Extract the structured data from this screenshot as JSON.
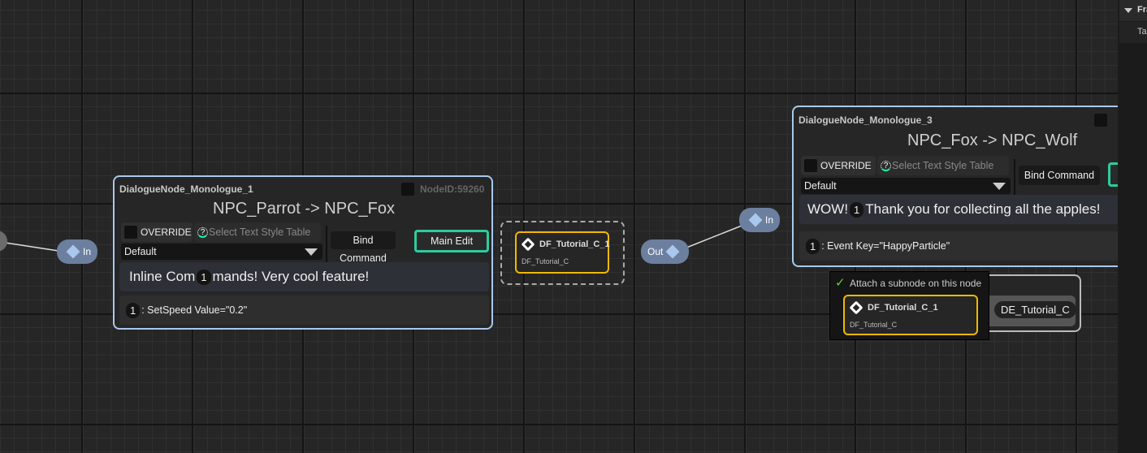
{
  "node1": {
    "title": "DialogueNode_Monologue_1",
    "node_id": "NodeID:59260",
    "speakers": "NPC_Parrot -> NPC_Fox",
    "override": "OVERRIDE",
    "style_table": "Select Text Style Table",
    "style_value": "Default",
    "bind_command": "Bind Command",
    "main_edit": "Main Edit",
    "text_before": "Inline Com",
    "text_marker": "1",
    "text_after": "mands! Very cool feature!",
    "command_index": "1",
    "command": ": SetSpeed Value=\"0.2\"",
    "pin_in": "In"
  },
  "subnode1": {
    "title": "DF_Tutorial_C_1",
    "class": "DF_Tutorial_C"
  },
  "out_pin": "Out",
  "node3": {
    "title": "DialogueNode_Monologue_3",
    "speakers": "NPC_Fox -> NPC_Wolf",
    "override": "OVERRIDE",
    "style_table": "Select Text Style Table",
    "style_value": "Default",
    "bind_command": "Bind Command",
    "text_before": "WOW!",
    "text_marker": "1",
    "text_after": "Thank you for collecting all the apples!",
    "command_index": "1",
    "command": ": Event Key=\"HappyParticle\"",
    "pin_in": "In"
  },
  "tooltip": {
    "text": "Attach a subnode on this node",
    "sub_title": "DF_Tutorial_C_1",
    "sub_class": "DF_Tutorial_C",
    "target_label": "DE_Tutorial_C"
  },
  "panel": {
    "header": "Fra",
    "row": "Ta"
  }
}
